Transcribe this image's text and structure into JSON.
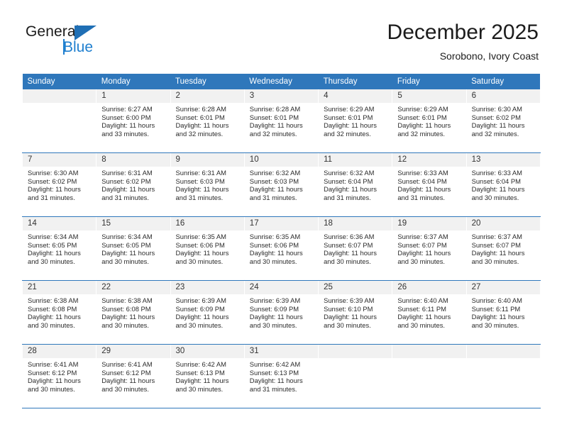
{
  "brand": {
    "name_part1": "General",
    "name_part2": "Blue"
  },
  "header": {
    "title": "December 2025",
    "location": "Sorobono, Ivory Coast"
  },
  "calendar": {
    "weekday_headers": [
      "Sunday",
      "Monday",
      "Tuesday",
      "Wednesday",
      "Thursday",
      "Friday",
      "Saturday"
    ],
    "accent_color": "#2f77bb",
    "daynum_band_color": "#f1f1f1",
    "weeks": [
      [
        {
          "day": "",
          "lines": []
        },
        {
          "day": "1",
          "lines": [
            "Sunrise: 6:27 AM",
            "Sunset: 6:00 PM",
            "Daylight: 11 hours",
            "and 33 minutes."
          ]
        },
        {
          "day": "2",
          "lines": [
            "Sunrise: 6:28 AM",
            "Sunset: 6:01 PM",
            "Daylight: 11 hours",
            "and 32 minutes."
          ]
        },
        {
          "day": "3",
          "lines": [
            "Sunrise: 6:28 AM",
            "Sunset: 6:01 PM",
            "Daylight: 11 hours",
            "and 32 minutes."
          ]
        },
        {
          "day": "4",
          "lines": [
            "Sunrise: 6:29 AM",
            "Sunset: 6:01 PM",
            "Daylight: 11 hours",
            "and 32 minutes."
          ]
        },
        {
          "day": "5",
          "lines": [
            "Sunrise: 6:29 AM",
            "Sunset: 6:01 PM",
            "Daylight: 11 hours",
            "and 32 minutes."
          ]
        },
        {
          "day": "6",
          "lines": [
            "Sunrise: 6:30 AM",
            "Sunset: 6:02 PM",
            "Daylight: 11 hours",
            "and 32 minutes."
          ]
        }
      ],
      [
        {
          "day": "7",
          "lines": [
            "Sunrise: 6:30 AM",
            "Sunset: 6:02 PM",
            "Daylight: 11 hours",
            "and 31 minutes."
          ]
        },
        {
          "day": "8",
          "lines": [
            "Sunrise: 6:31 AM",
            "Sunset: 6:02 PM",
            "Daylight: 11 hours",
            "and 31 minutes."
          ]
        },
        {
          "day": "9",
          "lines": [
            "Sunrise: 6:31 AM",
            "Sunset: 6:03 PM",
            "Daylight: 11 hours",
            "and 31 minutes."
          ]
        },
        {
          "day": "10",
          "lines": [
            "Sunrise: 6:32 AM",
            "Sunset: 6:03 PM",
            "Daylight: 11 hours",
            "and 31 minutes."
          ]
        },
        {
          "day": "11",
          "lines": [
            "Sunrise: 6:32 AM",
            "Sunset: 6:04 PM",
            "Daylight: 11 hours",
            "and 31 minutes."
          ]
        },
        {
          "day": "12",
          "lines": [
            "Sunrise: 6:33 AM",
            "Sunset: 6:04 PM",
            "Daylight: 11 hours",
            "and 31 minutes."
          ]
        },
        {
          "day": "13",
          "lines": [
            "Sunrise: 6:33 AM",
            "Sunset: 6:04 PM",
            "Daylight: 11 hours",
            "and 30 minutes."
          ]
        }
      ],
      [
        {
          "day": "14",
          "lines": [
            "Sunrise: 6:34 AM",
            "Sunset: 6:05 PM",
            "Daylight: 11 hours",
            "and 30 minutes."
          ]
        },
        {
          "day": "15",
          "lines": [
            "Sunrise: 6:34 AM",
            "Sunset: 6:05 PM",
            "Daylight: 11 hours",
            "and 30 minutes."
          ]
        },
        {
          "day": "16",
          "lines": [
            "Sunrise: 6:35 AM",
            "Sunset: 6:06 PM",
            "Daylight: 11 hours",
            "and 30 minutes."
          ]
        },
        {
          "day": "17",
          "lines": [
            "Sunrise: 6:35 AM",
            "Sunset: 6:06 PM",
            "Daylight: 11 hours",
            "and 30 minutes."
          ]
        },
        {
          "day": "18",
          "lines": [
            "Sunrise: 6:36 AM",
            "Sunset: 6:07 PM",
            "Daylight: 11 hours",
            "and 30 minutes."
          ]
        },
        {
          "day": "19",
          "lines": [
            "Sunrise: 6:37 AM",
            "Sunset: 6:07 PM",
            "Daylight: 11 hours",
            "and 30 minutes."
          ]
        },
        {
          "day": "20",
          "lines": [
            "Sunrise: 6:37 AM",
            "Sunset: 6:07 PM",
            "Daylight: 11 hours",
            "and 30 minutes."
          ]
        }
      ],
      [
        {
          "day": "21",
          "lines": [
            "Sunrise: 6:38 AM",
            "Sunset: 6:08 PM",
            "Daylight: 11 hours",
            "and 30 minutes."
          ]
        },
        {
          "day": "22",
          "lines": [
            "Sunrise: 6:38 AM",
            "Sunset: 6:08 PM",
            "Daylight: 11 hours",
            "and 30 minutes."
          ]
        },
        {
          "day": "23",
          "lines": [
            "Sunrise: 6:39 AM",
            "Sunset: 6:09 PM",
            "Daylight: 11 hours",
            "and 30 minutes."
          ]
        },
        {
          "day": "24",
          "lines": [
            "Sunrise: 6:39 AM",
            "Sunset: 6:09 PM",
            "Daylight: 11 hours",
            "and 30 minutes."
          ]
        },
        {
          "day": "25",
          "lines": [
            "Sunrise: 6:39 AM",
            "Sunset: 6:10 PM",
            "Daylight: 11 hours",
            "and 30 minutes."
          ]
        },
        {
          "day": "26",
          "lines": [
            "Sunrise: 6:40 AM",
            "Sunset: 6:11 PM",
            "Daylight: 11 hours",
            "and 30 minutes."
          ]
        },
        {
          "day": "27",
          "lines": [
            "Sunrise: 6:40 AM",
            "Sunset: 6:11 PM",
            "Daylight: 11 hours",
            "and 30 minutes."
          ]
        }
      ],
      [
        {
          "day": "28",
          "lines": [
            "Sunrise: 6:41 AM",
            "Sunset: 6:12 PM",
            "Daylight: 11 hours",
            "and 30 minutes."
          ]
        },
        {
          "day": "29",
          "lines": [
            "Sunrise: 6:41 AM",
            "Sunset: 6:12 PM",
            "Daylight: 11 hours",
            "and 30 minutes."
          ]
        },
        {
          "day": "30",
          "lines": [
            "Sunrise: 6:42 AM",
            "Sunset: 6:13 PM",
            "Daylight: 11 hours",
            "and 30 minutes."
          ]
        },
        {
          "day": "31",
          "lines": [
            "Sunrise: 6:42 AM",
            "Sunset: 6:13 PM",
            "Daylight: 11 hours",
            "and 31 minutes."
          ]
        },
        {
          "day": "",
          "lines": []
        },
        {
          "day": "",
          "lines": []
        },
        {
          "day": "",
          "lines": []
        }
      ]
    ]
  }
}
